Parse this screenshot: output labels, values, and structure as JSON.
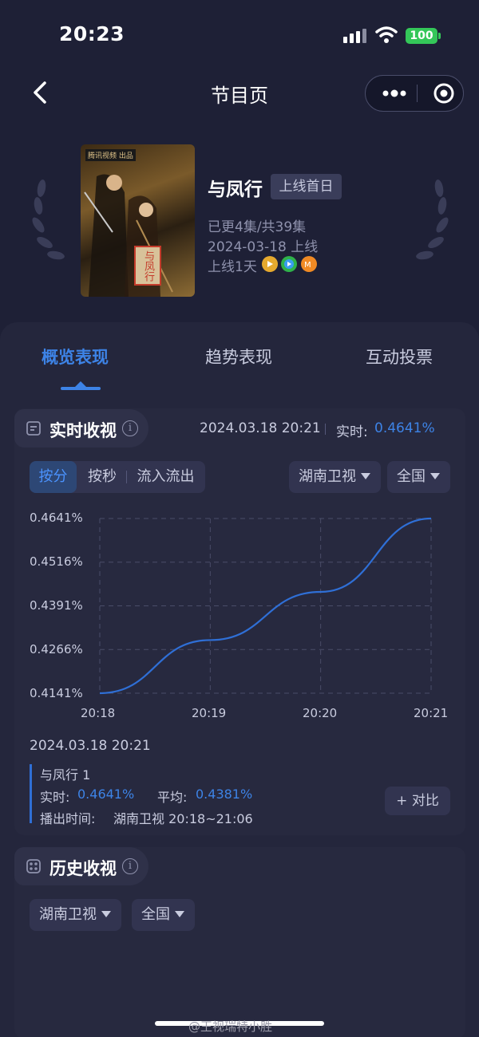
{
  "status_bar": {
    "time": "20:23",
    "battery": "100"
  },
  "nav": {
    "title": "节目页"
  },
  "show": {
    "poster_label": "腾讯视频 出品",
    "poster_title": "与凤行",
    "name": "与凤行",
    "badge": "上线首日",
    "episodes": "已更4集/共39集",
    "release": "2024-03-18 上线",
    "online_days": "上线1天",
    "platform_icons": [
      "tencent-video-icon",
      "iqiyi-icon",
      "mgtv-icon"
    ]
  },
  "tabs": [
    {
      "label": "概览表现",
      "active": true
    },
    {
      "label": "趋势表现",
      "active": false
    },
    {
      "label": "互动投票",
      "active": false
    }
  ],
  "realtime": {
    "title": "实时收视",
    "timestamp": "2024.03.18 20:21",
    "realtime_label": "实时:",
    "realtime_value": "0.4641%",
    "segments": [
      "按分",
      "按秒",
      "流入流出"
    ],
    "channel": "湖南卫视",
    "region": "全国"
  },
  "chart_data": {
    "type": "line",
    "x": [
      "20:18",
      "20:19",
      "20:20",
      "20:21"
    ],
    "y_ticks": [
      "0.4641%",
      "0.4516%",
      "0.4391%",
      "0.4266%",
      "0.4141%"
    ],
    "ylim": [
      0.4141,
      0.4641
    ],
    "series": [
      {
        "values": [
          0.4141,
          0.4293,
          0.4431,
          0.4641
        ]
      }
    ],
    "grid": true,
    "color": "#2f6fd6"
  },
  "detail": {
    "timestamp": "2024.03.18 20:21",
    "series_name": "与凤行 1",
    "realtime_label": "实时:",
    "realtime_value": "0.4641%",
    "avg_label": "平均:",
    "avg_value": "0.4381%",
    "airtime_label": "播出时间:",
    "airtime_value": "湖南卫视 20:18~21:06",
    "compare_label": "+ 对比"
  },
  "history": {
    "title": "历史收视",
    "channel": "湖南卫视",
    "region": "全国"
  },
  "watermark": "@王视瑞特小胜"
}
